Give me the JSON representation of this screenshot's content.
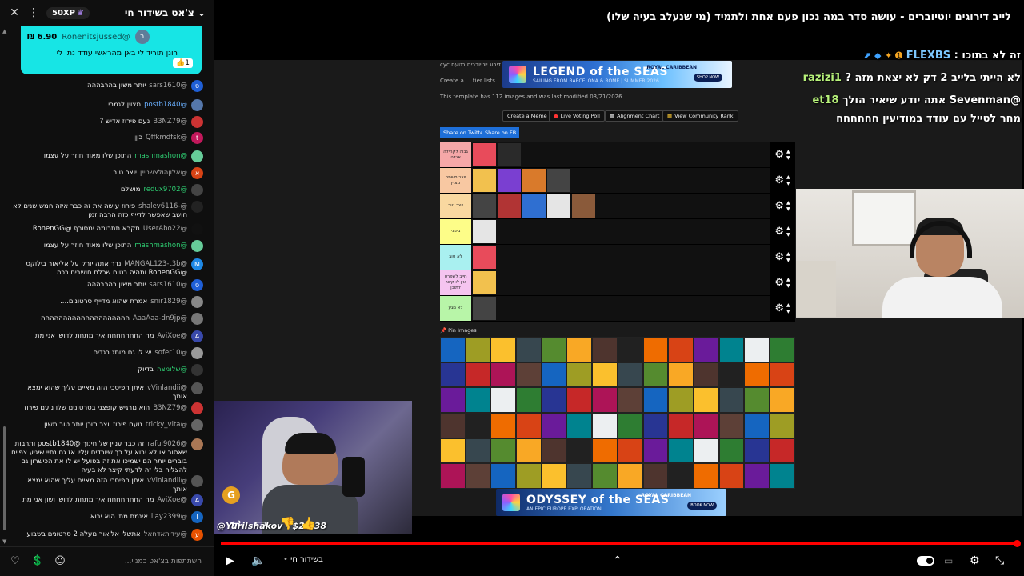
{
  "chat": {
    "title": "צ'אט בשידור חי",
    "xp": "50XP",
    "input_placeholder": "השתתפות בצ'אט כמנוי...",
    "superchat": {
      "avatar_letter": "ר",
      "name": "@Ronenitsjussed",
      "amount": "6.90 ₪",
      "message": "רונן תוריד לי באן מהראשי עודד נתן לי",
      "likes": "1"
    },
    "messages": [
      {
        "avatar": "ס",
        "color": "#1f5fd6",
        "name": "@sars1610",
        "name_style": "",
        "text": "יותר משון בהרבההה"
      },
      {
        "avatar": "",
        "color": "#5577aa",
        "name": "@postb1840",
        "name_style": "blue",
        "text": "מצוין לגמרי"
      },
      {
        "avatar": "",
        "color": "#c33",
        "name": "@B3NZ79",
        "name_style": "",
        "text": "נעם פירוז אדיש ?"
      },
      {
        "avatar": "t",
        "color": "#c2185b",
        "name": "@Qffkmdfsk",
        "name_style": "",
        "text": "כןןן"
      },
      {
        "avatar": "",
        "color": "#6c9",
        "name": "@mashmashon",
        "name_style": "green",
        "text": "התוכן שלו מאוד חוזר על עצמו"
      },
      {
        "avatar": "א",
        "color": "#d84315",
        "name": "@אלוןהולצשטיין",
        "name_style": "",
        "text": "יוצר טוב"
      },
      {
        "avatar": "",
        "color": "#444",
        "name": "@redux9702",
        "name_style": "green",
        "text": "מושלם"
      },
      {
        "avatar": "",
        "color": "#222",
        "name": "@-shalev6116",
        "name_style": "",
        "text": "פירוז עושה את זה כבר איזה חמש שנים לא חושב שאפשר לדייף כזה הרבה זמן"
      },
      {
        "avatar": "",
        "color": "#111",
        "name": "@UserAbo22",
        "name_style": "",
        "text": "תקרא תתרומה ימסורף @RonenGG"
      },
      {
        "avatar": "",
        "color": "#6c9",
        "name": "@mashmashon",
        "name_style": "green",
        "text": "התוכן שלו מאוד חוזר על עצמו"
      },
      {
        "avatar": "M",
        "color": "#1e88e5",
        "name": "@MANGAL123-t3b",
        "name_style": "",
        "text": "נדר אתה יורק על אליאור בילוקס @RonenGG ותהיה בטוח שכלם חושבים ככה"
      },
      {
        "avatar": "ס",
        "color": "#1f5fd6",
        "name": "@sars1610",
        "name_style": "",
        "text": "יותר משון בהרבההה"
      },
      {
        "avatar": "",
        "color": "#888",
        "name": "@snir1829",
        "name_style": "",
        "text": "אמרת שהוא מדייף סרטונים...."
      },
      {
        "avatar": "",
        "color": "#777",
        "name": "@AaaAaa-dn9jp",
        "name_style": "",
        "text": "הההההההההההההההההההה"
      },
      {
        "avatar": "A",
        "color": "#3949ab",
        "name": "@AviXoe",
        "name_style": "",
        "text": "מה החחחחחחח איך מתחת לדושי אני מת"
      },
      {
        "avatar": "",
        "color": "#999",
        "name": "@sofer10",
        "name_style": "",
        "text": "יש לו גם מותג בגדים"
      },
      {
        "avatar": "",
        "color": "#333",
        "name": "@שלומצה",
        "name_style": "green",
        "text": "בדיוק"
      },
      {
        "avatar": "",
        "color": "#555",
        "name": "@vVinlandii",
        "name_style": "",
        "text": "איתן הפיסכי הזה מאיים עליך שהוא ימצא אותך"
      },
      {
        "avatar": "",
        "color": "#c33",
        "name": "@B3NZ79",
        "name_style": "",
        "text": "הוא מרגיש קופצני בסרטונים שלו נועם פירוז"
      },
      {
        "avatar": "",
        "color": "#666",
        "name": "@tricky_vita",
        "name_style": "",
        "text": "נועם פירוז יוצר תוכן יותר טוב משון"
      },
      {
        "avatar": "",
        "color": "#aa7755",
        "name": "@rafui9026",
        "name_style": "",
        "text": "זה כבר עניין של חינוך @postb1840 ותרבות שאסור או לא יבוא על כך שיורדים עליו אז גם נתיי שיגיע צפיים בוברים יותר הם ישמיכו את זה בפועל יש לו את הכישרון גם להצליח בלי זה לדעתי קיצר לא בעיה"
      },
      {
        "avatar": "",
        "color": "#555",
        "name": "@vVinlandii",
        "name_style": "",
        "text": "איתן הפיסכי הזה מאיים עליך שהוא ימצא אותך"
      },
      {
        "avatar": "A",
        "color": "#3949ab",
        "name": "@AviXoe",
        "name_style": "",
        "text": "מה החחחחחחח איך מתחת לדושי ושון אני מת"
      },
      {
        "avatar": "I",
        "color": "#1565c0",
        "name": "@ilay2399",
        "name_style": "",
        "text": "אינמת מתי הוא יבוא"
      },
      {
        "avatar": "ע",
        "color": "#e65100",
        "name": "@עידיתאדחאל",
        "name_style": "",
        "text": "אתשלי אליאור מעלה 2 סרטונים בשבוע"
      }
    ]
  },
  "stream": {
    "title": "לייב דירוגים יוטיוברים - עושה סדר במה נכון פעם אחת ולתמיד (מי שנעלב בעיה שלו)",
    "donation": "@YuriIshakov - $22.38",
    "live_label": "בשידור חי",
    "logo_letter": "G"
  },
  "page": {
    "ad_top_title": "LEGEND of the SEAS",
    "ad_top_sub": "SAILING FROM BARCELONA & ROME | SUMMER 2026",
    "ad_bottom_title": "ODYSSEY of the SEAS",
    "ad_bottom_sub": "AN EPIC EUROPE EXPLORATION",
    "ad_brand": "ROYAL CARIBBEAN",
    "ad_cta_top": "SHOP NOW",
    "ad_cta_bottom": "BOOK NOW",
    "line1": "cyc דירוג יוטיוברים בטעם",
    "line2": "Create a ... tier lists.",
    "line3": "This template has 112 images and was last modified 03/21/2026.",
    "tools": [
      "Create a Meme",
      "Live Voting Poll",
      "Alignment Chart",
      "View Community Rank"
    ],
    "share": [
      "Share on Twitter",
      "Share on FB"
    ],
    "pin_label": "Pin Images",
    "tiers": [
      {
        "label": "גבוה לקהילה אגדה",
        "color": "#f5a7a8",
        "count": 2
      },
      {
        "label": "יוצר משמח מצוין",
        "color": "#f8c8a2",
        "count": 4
      },
      {
        "label": "יוצר טוב",
        "color": "#f9d8a0",
        "count": 5
      },
      {
        "label": "בינוני",
        "color": "#fdfd88",
        "count": 1
      },
      {
        "label": "לא טוב",
        "color": "#a9f0f0",
        "count": 1
      },
      {
        "label": "חייב לשפרט אין לו קשר לתוכן",
        "color": "#f5c4f0",
        "count": 1
      },
      {
        "label": "לא נוגע",
        "color": "#b8f5a8",
        "count": 1
      }
    ]
  },
  "overlay": [
    {
      "user": "FLEXBS",
      "text": "זה לא בתוכו :"
    },
    {
      "user": "razizi1",
      "text": "לא הייתי בלייב 2 דק לא יצאת מזה ?"
    },
    {
      "user": "et18",
      "text": "@Sevenman אתה יודע שיאיר הולך"
    },
    {
      "user": "",
      "text": "מחר לטייל עם עודד במודיעין חחחחחח"
    }
  ]
}
